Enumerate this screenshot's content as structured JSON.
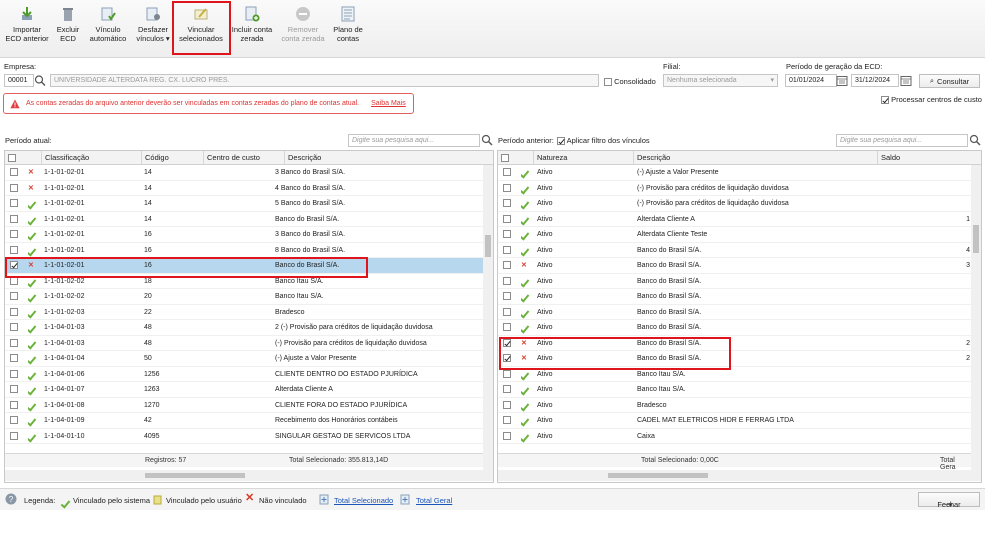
{
  "toolbar": {
    "importar": "Importar\nECD anterior",
    "excluir": "Excluir\nECD",
    "vinculo": "Vínculo\nautomático",
    "desfazer": "Desfazer\nvínculos ▾",
    "vincular": "Vincular\nselecionados",
    "incluir": "Incluir conta\nzerada",
    "remover": "Remover\nconta zerada",
    "plano": "Plano de\ncontas"
  },
  "filters": {
    "empresa_label": "Empresa:",
    "empresa_code": "00001",
    "empresa_name": "UNIVERSIDADE ALTERDATA REG. CX. LUCRO PRES.",
    "consolidado": "Consolidado",
    "filial_label": "Filial:",
    "filial_value": "Nenhuma selecionada",
    "periodo_label": "Período de geração da ECD:",
    "data_ini": "01/01/2024",
    "data_fim": "31/12/2024",
    "consultar": "Consultar",
    "processar": "Processar centros de custo"
  },
  "warning": {
    "text": "As contas zeradas do arquivo anterior deverão ser vinculadas em contas zeradas do plano de contas atual.",
    "link": "Saiba Mais"
  },
  "left": {
    "title": "Período atual:",
    "search_placeholder": "Digite sua pesquisa aqui...",
    "columns": [
      "Classificação",
      "Código",
      "Centro de custo",
      "Descrição"
    ],
    "rows": [
      {
        "status": "no",
        "checked": false,
        "cls": "1-1-01-02-01",
        "cod": "14",
        "cc": "",
        "desc": "3 Banco do Brasil S/A."
      },
      {
        "status": "no",
        "checked": false,
        "cls": "1-1-01-02-01",
        "cod": "14",
        "cc": "",
        "desc": "4 Banco do Brasil S/A."
      },
      {
        "status": "ok",
        "checked": false,
        "cls": "1-1-01-02-01",
        "cod": "14",
        "cc": "",
        "desc": "5 Banco do Brasil S/A."
      },
      {
        "status": "ok",
        "checked": false,
        "cls": "1-1-01-02-01",
        "cod": "14",
        "cc": "",
        "desc": "Banco do Brasil S/A."
      },
      {
        "status": "ok",
        "checked": false,
        "cls": "1-1-01-02-01",
        "cod": "16",
        "cc": "",
        "desc": "3 Banco do Brasil S/A."
      },
      {
        "status": "ok",
        "checked": false,
        "cls": "1-1-01-02-01",
        "cod": "16",
        "cc": "",
        "desc": "8 Banco do Brasil S/A."
      },
      {
        "status": "no",
        "checked": true,
        "cls": "1-1-01-02-01",
        "cod": "16",
        "cc": "",
        "desc": "Banco do Brasil S/A."
      },
      {
        "status": "ok",
        "checked": false,
        "cls": "1-1-01-02-02",
        "cod": "18",
        "cc": "",
        "desc": "Banco Itau S/A."
      },
      {
        "status": "ok",
        "checked": false,
        "cls": "1-1-01-02-02",
        "cod": "20",
        "cc": "",
        "desc": "Banco Itau S/A."
      },
      {
        "status": "ok",
        "checked": false,
        "cls": "1-1-01-02-03",
        "cod": "22",
        "cc": "",
        "desc": "Bradesco"
      },
      {
        "status": "ok",
        "checked": false,
        "cls": "1-1-04-01-03",
        "cod": "48",
        "cc": "",
        "desc": "2 (-) Provisão para créditos de liquidação duvidosa"
      },
      {
        "status": "ok",
        "checked": false,
        "cls": "1-1-04-01-03",
        "cod": "48",
        "cc": "",
        "desc": "(-) Provisão para créditos de liquidação duvidosa"
      },
      {
        "status": "ok",
        "checked": false,
        "cls": "1-1-04-01-04",
        "cod": "50",
        "cc": "",
        "desc": "(-) Ajuste a Valor Presente"
      },
      {
        "status": "ok",
        "checked": false,
        "cls": "1-1-04-01-06",
        "cod": "1256",
        "cc": "",
        "desc": "CLIENTE DENTRO DO ESTADO PJURÍDICA"
      },
      {
        "status": "ok",
        "checked": false,
        "cls": "1-1-04-01-07",
        "cod": "1263",
        "cc": "",
        "desc": "Alterdata Cliente A"
      },
      {
        "status": "ok",
        "checked": false,
        "cls": "1-1-04-01-08",
        "cod": "1270",
        "cc": "",
        "desc": "CLIENTE FORA DO ESTADO PJURÍDICA"
      },
      {
        "status": "ok",
        "checked": false,
        "cls": "1-1-04-01-09",
        "cod": "42",
        "cc": "",
        "desc": "Recebimento dos Honorários contábeis"
      },
      {
        "status": "ok",
        "checked": false,
        "cls": "1-1-04-01-10",
        "cod": "4095",
        "cc": "",
        "desc": "SINGULAR GESTAO DE SERVICOS LTDA"
      }
    ],
    "registros": "Registros: 57",
    "total": "Total Selecionado: 355.813,14D"
  },
  "right": {
    "title": "Período anterior:",
    "filtro": "Aplicar filtro dos vínculos",
    "search_placeholder": "Digite sua pesquisa aqui...",
    "columns": [
      "Natureza",
      "Descrição",
      "Saldo"
    ],
    "rows": [
      {
        "status": "ok",
        "checked": false,
        "nat": "Ativo",
        "desc": "(-) Ajuste a Valor Presente",
        "saldo": ""
      },
      {
        "status": "ok",
        "checked": false,
        "nat": "Ativo",
        "desc": "(-) Provisão para créditos de liquidação duvidosa",
        "saldo": ""
      },
      {
        "status": "ok",
        "checked": false,
        "nat": "Ativo",
        "desc": "(-) Provisão para créditos de liquidação duvidosa",
        "saldo": ""
      },
      {
        "status": "ok",
        "checked": false,
        "nat": "Ativo",
        "desc": "Alterdata Cliente A",
        "saldo": "1"
      },
      {
        "status": "ok",
        "checked": false,
        "nat": "Ativo",
        "desc": "Alterdata Cliente Teste",
        "saldo": ""
      },
      {
        "status": "ok",
        "checked": false,
        "nat": "Ativo",
        "desc": "Banco do Brasil S/A.",
        "saldo": "4"
      },
      {
        "status": "no",
        "checked": false,
        "nat": "Ativo",
        "desc": "Banco do Brasil S/A.",
        "saldo": "3"
      },
      {
        "status": "ok",
        "checked": false,
        "nat": "Ativo",
        "desc": "Banco do Brasil S/A.",
        "saldo": ""
      },
      {
        "status": "ok",
        "checked": false,
        "nat": "Ativo",
        "desc": "Banco do Brasil S/A.",
        "saldo": ""
      },
      {
        "status": "ok",
        "checked": false,
        "nat": "Ativo",
        "desc": "Banco do Brasil S/A.",
        "saldo": ""
      },
      {
        "status": "ok",
        "checked": false,
        "nat": "Ativo",
        "desc": "Banco do Brasil S/A.",
        "saldo": ""
      },
      {
        "status": "no",
        "checked": true,
        "nat": "Ativo",
        "desc": "Banco do Brasil S/A.",
        "saldo": "2"
      },
      {
        "status": "no",
        "checked": true,
        "nat": "Ativo",
        "desc": "Banco do Brasil S/A.",
        "saldo": "2"
      },
      {
        "status": "ok",
        "checked": false,
        "nat": "Ativo",
        "desc": "Banco Itau S/A.",
        "saldo": ""
      },
      {
        "status": "ok",
        "checked": false,
        "nat": "Ativo",
        "desc": "Banco Itau S/A.",
        "saldo": ""
      },
      {
        "status": "ok",
        "checked": false,
        "nat": "Ativo",
        "desc": "Bradesco",
        "saldo": ""
      },
      {
        "status": "ok",
        "checked": false,
        "nat": "Ativo",
        "desc": "CADEL MAT ELETRICOS HIDR E FERRAG LTDA",
        "saldo": ""
      },
      {
        "status": "ok",
        "checked": false,
        "nat": "Ativo",
        "desc": "Caixa",
        "saldo": ""
      }
    ],
    "total": "Total Selecionado: 0,00C",
    "total_geral": "Total Gera"
  },
  "legend": {
    "label": "Legenda:",
    "sistema": "Vinculado pelo sistema",
    "usuario": "Vinculado pelo usuário",
    "nao": "Não vinculado",
    "total_sel": "Total Selecionado",
    "total_geral": "Total Geral",
    "fechar": "Fechar"
  },
  "colors": {
    "accent_red": "#e0141b",
    "ok_green": "#6bb23a",
    "no_red": "#d83a2a",
    "highlight": "#b7d7ee",
    "link": "#1a55b8"
  }
}
